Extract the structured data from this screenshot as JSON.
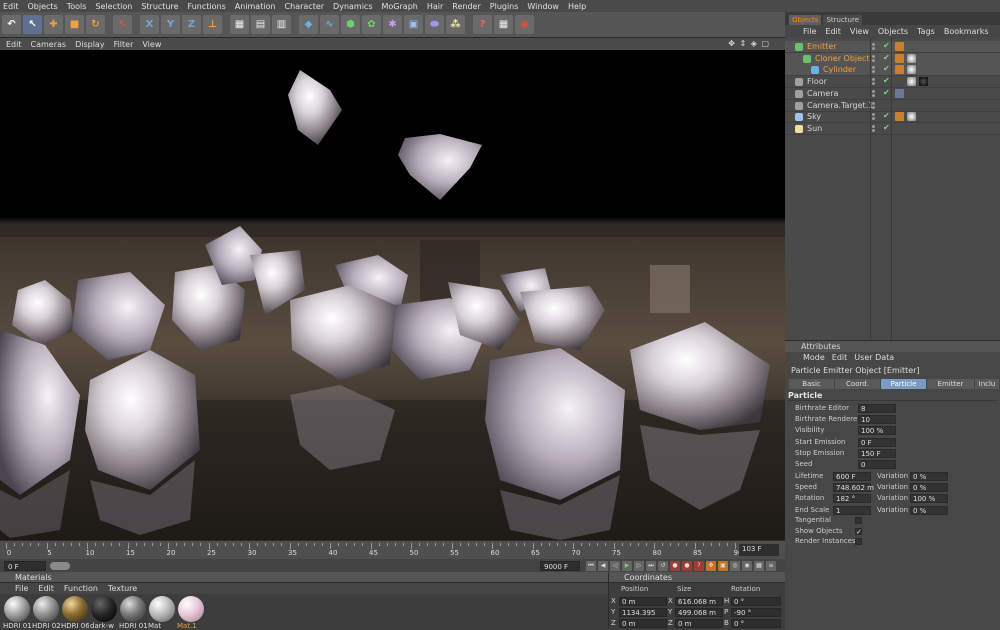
{
  "menubar": [
    "Edit",
    "Objects",
    "Tools",
    "Selection",
    "Structure",
    "Functions",
    "Animation",
    "Character",
    "Dynamics",
    "MoGraph",
    "Hair",
    "Render",
    "Plugins",
    "Window",
    "Help"
  ],
  "viewport_menu": [
    "Edit",
    "Cameras",
    "Display",
    "Filter",
    "View"
  ],
  "viewport_controls": "✥ ⇕ ◈ ▢",
  "timeline": {
    "ticks": [
      "0",
      "5",
      "10",
      "15",
      "20",
      "25",
      "30",
      "35",
      "40",
      "45",
      "50",
      "55",
      "60",
      "65",
      "70",
      "75",
      "80",
      "85",
      "90"
    ],
    "end_frame": "103 F"
  },
  "transport": {
    "current": "0 F",
    "max": "9000 F"
  },
  "materials": {
    "title": "Materials",
    "menu": [
      "File",
      "Edit",
      "Function",
      "Texture"
    ],
    "items": [
      {
        "label": "HDRI 01"
      },
      {
        "label": "HDRI 02"
      },
      {
        "label": "HDRI 06"
      },
      {
        "label": "dark-w"
      },
      {
        "label": "HDRI 01"
      },
      {
        "label": "Mat"
      },
      {
        "label": "Mat.1"
      }
    ]
  },
  "coordinates": {
    "title": "Coordinates",
    "headers": [
      "Position",
      "Size",
      "Rotation"
    ],
    "rows": [
      {
        "axis": "X",
        "pos": "0 m",
        "saxis": "X",
        "size": "616.068 m",
        "raxis": "H",
        "rot": "0 °"
      },
      {
        "axis": "Y",
        "pos": "1134.395 m",
        "saxis": "Y",
        "size": "499.068 m",
        "raxis": "P",
        "rot": "-90 °"
      },
      {
        "axis": "Z",
        "pos": "0 m",
        "saxis": "Z",
        "size": "0 m",
        "raxis": "B",
        "rot": "0 °"
      }
    ]
  },
  "object_manager": {
    "tabs": [
      "Objects",
      "Structure"
    ],
    "menu": [
      "File",
      "Edit",
      "View",
      "Objects",
      "Tags",
      "Bookmarks"
    ],
    "objects": [
      {
        "name": "Emitter",
        "color": "#f0a040",
        "highlight": true
      },
      {
        "name": "Cloner Object",
        "color": "#f0a040",
        "highlight": true
      },
      {
        "name": "Cylinder",
        "color": "#f0a040",
        "highlight": true
      },
      {
        "name": "Floor",
        "color": "#d4d4d4",
        "highlight": false
      },
      {
        "name": "Camera",
        "color": "#d4d4d4",
        "highlight": false
      },
      {
        "name": "Camera.Target.1",
        "color": "#d4d4d4",
        "highlight": false
      },
      {
        "name": "Sky",
        "color": "#d4d4d4",
        "highlight": false
      },
      {
        "name": "Sun",
        "color": "#d4d4d4",
        "highlight": false
      }
    ]
  },
  "attributes": {
    "title": "Attributes",
    "menu": [
      "Mode",
      "Edit",
      "User Data"
    ],
    "object_title": "Particle Emitter Object [Emitter]",
    "tabs": [
      "Basic",
      "Coord.",
      "Particle",
      "Emitter",
      "Inclu"
    ],
    "active_tab": "Particle",
    "section": "Particle",
    "fields": [
      {
        "label": "Birthrate Editor",
        "value": "8"
      },
      {
        "label": "Birthrate Renderer",
        "value": "10"
      },
      {
        "label": "Visibility",
        "value": "100 %"
      },
      {
        "label": "Start Emission",
        "value": "0 F"
      },
      {
        "label": "Stop Emission",
        "value": "150 F"
      },
      {
        "label": "Seed",
        "value": "0"
      }
    ],
    "pair_fields": [
      {
        "label": "Lifetime",
        "value": "600 F",
        "vlabel": "Variation",
        "vvalue": "0 %"
      },
      {
        "label": "Speed",
        "value": "748.602 m",
        "vlabel": "Variation",
        "vvalue": "0 %"
      },
      {
        "label": "Rotation",
        "value": "182 °",
        "vlabel": "Variation",
        "vvalue": "100 %"
      },
      {
        "label": "End Scale",
        "value": "1",
        "vlabel": "Variation",
        "vvalue": "0 %"
      }
    ],
    "checks": [
      {
        "label": "Tangential",
        "checked": false
      },
      {
        "label": "Show Objects",
        "checked": true
      },
      {
        "label": "Render Instances",
        "checked": false
      }
    ]
  },
  "colors": {
    "accent": "#f08a1e",
    "active_tab": "#7b9ac4",
    "panel": "#474747"
  }
}
